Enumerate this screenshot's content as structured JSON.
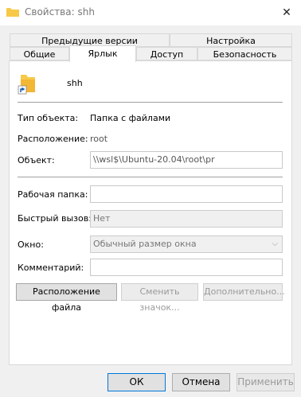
{
  "window": {
    "title": "Свойства: shh"
  },
  "tabs_back": [
    "Предыдущие версии",
    "Настройка"
  ],
  "tabs_front": [
    "Общие",
    "Ярлык",
    "Доступ",
    "Безопасность"
  ],
  "shortcut": {
    "name": "shh",
    "type_label": "Тип объекта:",
    "type_value": "Папка с файлами",
    "location_label": "Расположение:",
    "location_value": "root",
    "target_label": "Объект:",
    "target_value": "\\\\wsl$\\Ubuntu-20.04\\root\\pr",
    "start_in_label": "Рабочая папка:",
    "start_in_value": "",
    "hotkey_label": "Быстрый вызов:",
    "hotkey_value": "Нет",
    "run_label": "Окно:",
    "run_value": "Обычный размер окна",
    "comment_label": "Комментарий:",
    "comment_value": ""
  },
  "actions": {
    "open_location": "Расположение файла",
    "change_icon": "Сменить значок...",
    "advanced": "Дополнительно..."
  },
  "footer": {
    "ok": "ОК",
    "cancel": "Отмена",
    "apply": "Применить"
  },
  "colors": {
    "accent": "#0078d7",
    "folder": "#f7c948"
  }
}
